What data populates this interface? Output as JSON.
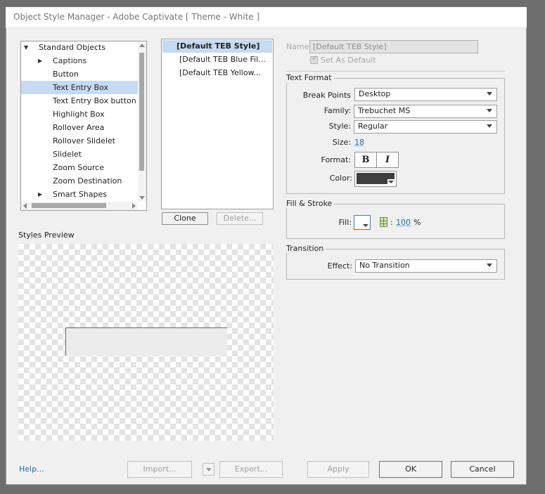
{
  "window": {
    "title": "Object Style Manager - Adobe Captivate [ Theme - White ]"
  },
  "tree": {
    "items": [
      {
        "label": "Standard Objects",
        "expander": "▼",
        "level": 0
      },
      {
        "label": "Captions",
        "expander": "▶",
        "level": 1
      },
      {
        "label": "Button",
        "expander": "",
        "level": 1
      },
      {
        "label": "Text Entry Box",
        "expander": "",
        "level": 1,
        "selected": true
      },
      {
        "label": "Text Entry Box button",
        "expander": "",
        "level": 1
      },
      {
        "label": "Highlight Box",
        "expander": "",
        "level": 1
      },
      {
        "label": "Rollover Area",
        "expander": "",
        "level": 1
      },
      {
        "label": "Rollover Slidelet",
        "expander": "",
        "level": 1
      },
      {
        "label": "Slidelet",
        "expander": "",
        "level": 1
      },
      {
        "label": "Zoom Source",
        "expander": "",
        "level": 1
      },
      {
        "label": "Zoom Destination",
        "expander": "",
        "level": 1
      },
      {
        "label": "Smart Shapes",
        "expander": "▶",
        "level": 1
      }
    ]
  },
  "styles_list": {
    "items": [
      {
        "label": "[Default TEB Style]",
        "selected": true
      },
      {
        "label": "[Default TEB Blue Fil..."
      },
      {
        "label": "[Default TEB Yellow..."
      }
    ],
    "clone_label": "Clone",
    "delete_label": "Delete..."
  },
  "preview": {
    "label": "Styles Preview"
  },
  "name_field": {
    "label": "Name",
    "value": "[Default TEB Style]",
    "set_default_label": "Set As Default",
    "set_default_checked": true
  },
  "text_format": {
    "title": "Text Format",
    "breakpoints_label": "Break Points",
    "breakpoints_value": "Desktop",
    "family_label": "Family:",
    "family_value": "Trebuchet MS",
    "style_label": "Style:",
    "style_value": "Regular",
    "size_label": "Size:",
    "size_value": "18",
    "format_label": "Format:",
    "bold_glyph": "B",
    "italic_glyph": "I",
    "color_label": "Color:",
    "color_value": "#3f3f3f"
  },
  "fill_stroke": {
    "title": "Fill & Stroke",
    "fill_label": "Fill:",
    "opacity_separator": ":",
    "opacity_value": "100",
    "opacity_unit": "%"
  },
  "transition": {
    "title": "Transition",
    "effect_label": "Effect:",
    "effect_value": "No Transition"
  },
  "footer": {
    "help_label": "Help...",
    "import_label": "Import...",
    "export_label": "Export...",
    "apply_label": "Apply",
    "ok_label": "OK",
    "cancel_label": "Cancel"
  }
}
